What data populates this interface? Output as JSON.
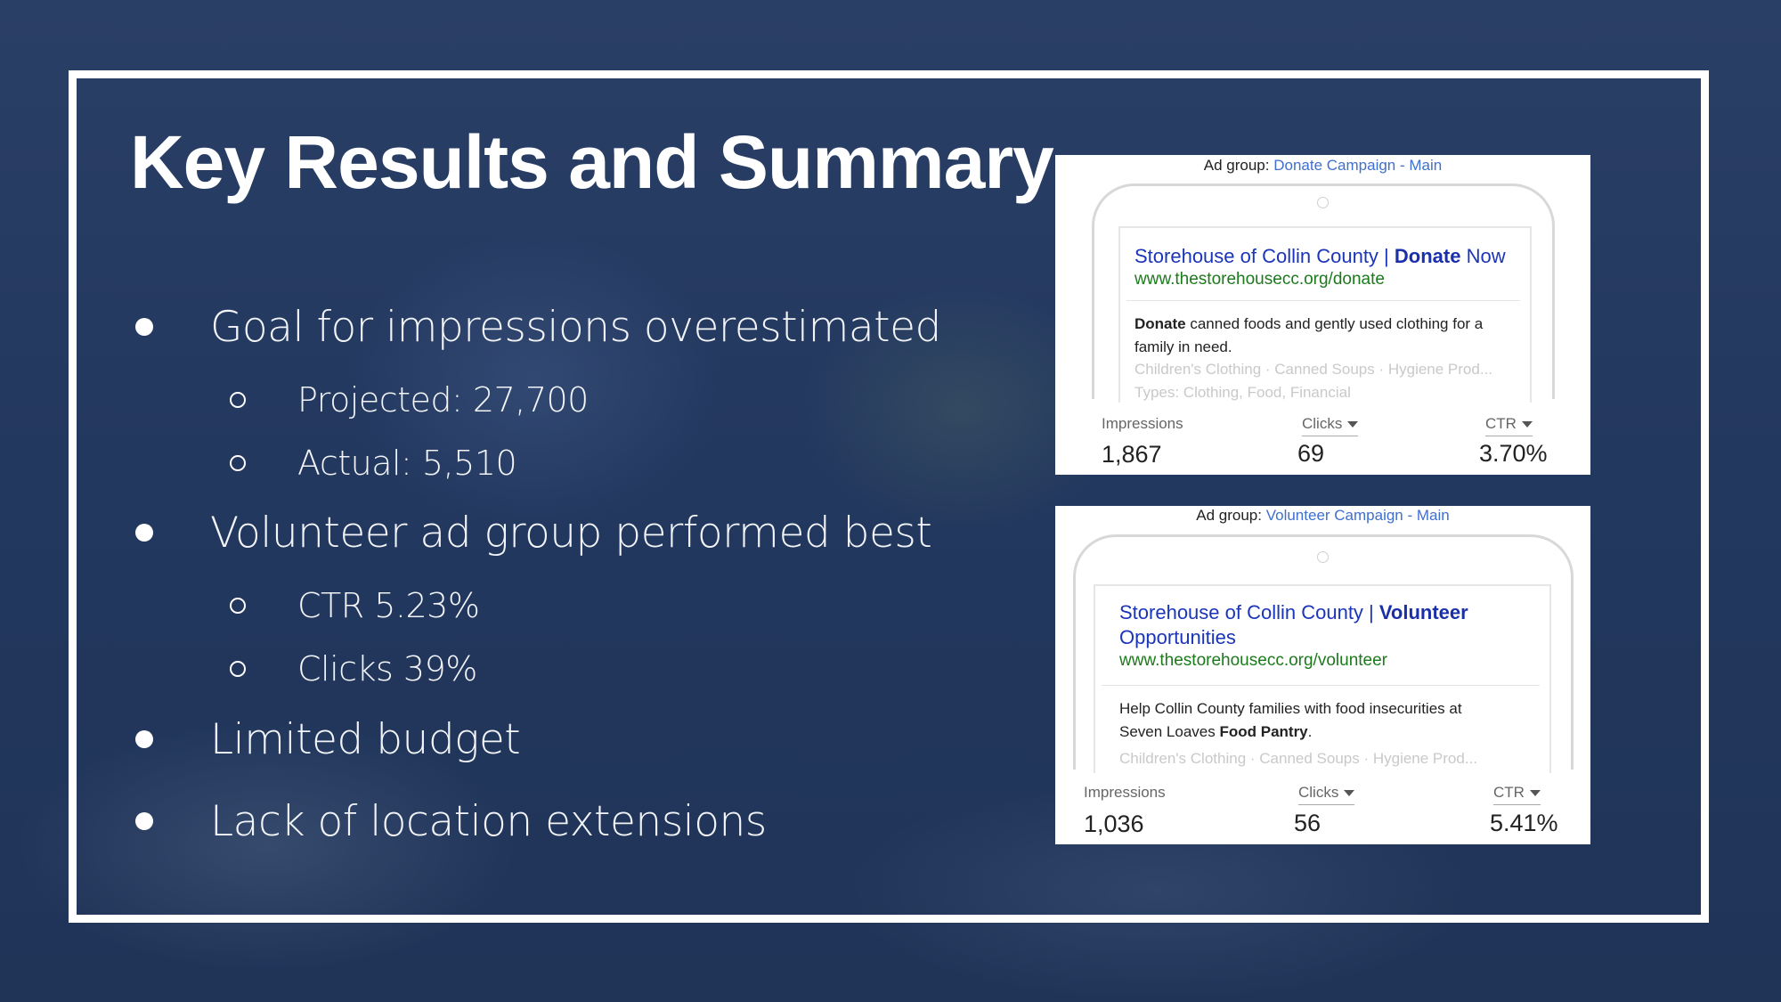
{
  "slide": {
    "title": "Key Results and Summary",
    "bullets": [
      {
        "level": 1,
        "text": "Goal for impressions overestimated"
      },
      {
        "level": 2,
        "text": "Projected: 27,700"
      },
      {
        "level": 2,
        "text": "Actual: 5,510"
      },
      {
        "level": 1,
        "text": "Volunteer ad group performed best"
      },
      {
        "level": 2,
        "text": "CTR 5.23%"
      },
      {
        "level": 2,
        "text": "Clicks 39%"
      },
      {
        "level": 1,
        "text": "Limited budget"
      },
      {
        "level": 1,
        "text": "Lack of location extensions"
      }
    ]
  },
  "ads": [
    {
      "ad_group_prefix": "Ad group:",
      "ad_group_name": "Donate Campaign - Main",
      "headline_part1": "Storehouse of Collin County | ",
      "headline_bold": "Donate",
      "headline_part2": " Now",
      "headline_line2": "",
      "url": "www.thestorehousecc.org/donate",
      "desc_bold_start": "Donate",
      "desc_text": " canned foods and gently used clothing for a family in need.",
      "desc_text_end": "",
      "desc_bold_end": "",
      "desc_period": "",
      "ext_line1": "Children's Clothing · Canned Soups · Hygiene Prod...",
      "ext_line2": "Types: Clothing, Food, Financial",
      "stats": {
        "impressions_label": "Impressions",
        "impressions": "1,867",
        "clicks_label": "Clicks",
        "clicks": "69",
        "ctr_label": "CTR",
        "ctr": "3.70%"
      }
    },
    {
      "ad_group_prefix": "Ad group:",
      "ad_group_name": "Volunteer Campaign - Main",
      "headline_part1": "Storehouse of Collin County | ",
      "headline_bold": "Volunteer",
      "headline_part2": "",
      "headline_line2": "Opportunities",
      "url": "www.thestorehousecc.org/volunteer",
      "desc_bold_start": "",
      "desc_text": "Help Collin County families with food insecurities at",
      "desc_text_end": "Seven Loaves ",
      "desc_bold_end": "Food Pantry",
      "desc_period": ".",
      "ext_line1": "Children's Clothing · Canned Soups · Hygiene Prod...",
      "ext_line2": "",
      "stats": {
        "impressions_label": "Impressions",
        "impressions": "1,036",
        "clicks_label": "Clicks",
        "clicks": "56",
        "ctr_label": "CTR",
        "ctr": "5.41%"
      }
    }
  ],
  "colors": {
    "background": "#23385f",
    "frame": "#ffffff",
    "ad_headline": "#1a35b8",
    "ad_url": "#1c7a1c",
    "ad_group_link": "#3f6fcf"
  }
}
